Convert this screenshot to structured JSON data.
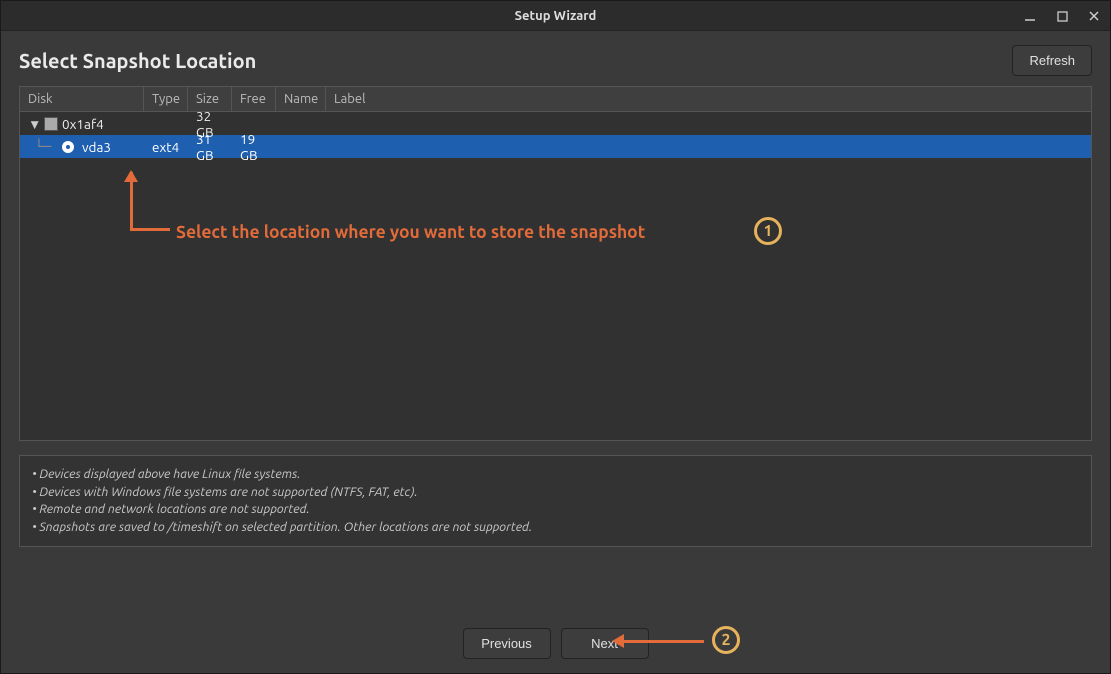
{
  "window": {
    "title": "Setup Wizard"
  },
  "page": {
    "title": "Select Snapshot Location",
    "refresh_label": "Refresh"
  },
  "columns": {
    "disk": "Disk",
    "type": "Type",
    "size": "Size",
    "free": "Free",
    "name": "Name",
    "label": "Label"
  },
  "rows": [
    {
      "indent": 0,
      "expanded": true,
      "icon": "disk",
      "name": "0x1af4",
      "type": "",
      "size": "32 GB",
      "free": "",
      "selected": false,
      "radio": false
    },
    {
      "indent": 1,
      "expanded": false,
      "icon": "radio",
      "name": "vda3",
      "type": "ext4",
      "size": "31 GB",
      "free": "19 GB",
      "selected": true,
      "radio": true
    }
  ],
  "notes": [
    "• Devices displayed above have Linux file systems.",
    "• Devices with Windows file systems are not supported (NTFS, FAT, etc).",
    "• Remote and network locations are not supported.",
    "• Snapshots are saved to /timeshift on selected partition. Other locations are not supported."
  ],
  "footer": {
    "previous": "Previous",
    "next": "Next"
  },
  "annotations": {
    "text1": "Select the location where you want to store the snapshot",
    "num1": "1",
    "num2": "2"
  }
}
